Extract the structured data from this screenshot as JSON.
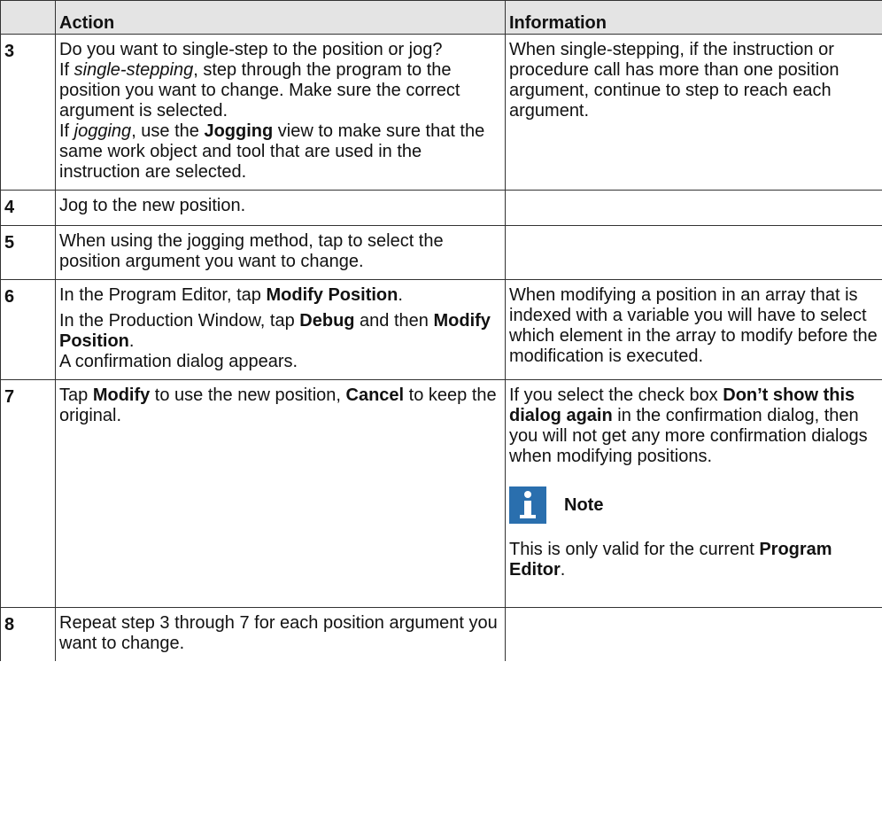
{
  "table": {
    "headers": {
      "step": "",
      "action": "Action",
      "information": "Information"
    },
    "rows": [
      {
        "step": "3",
        "action": {
          "p1": "Do you want to single-step to the position or jog?",
          "p2_pre": "If ",
          "p2_em": "single-stepping",
          "p2_post": ", step through the program to the position you want to change. Make sure the correct argument is selected.",
          "p3_pre": "If ",
          "p3_em": "jogging",
          "p3_mid": ", use the ",
          "p3_bold": "Jogging",
          "p3_post": " view to make sure that the same work object and tool that are used in the instruction are selected."
        },
        "info": "When single-stepping, if the instruction or procedure call has more than one position argument, continue to step to reach each argument."
      },
      {
        "step": "4",
        "action": "Jog to the new position.",
        "info": ""
      },
      {
        "step": "5",
        "action": "When using the jogging method, tap to select the position argument you want to change.",
        "info": ""
      },
      {
        "step": "6",
        "action": {
          "p1_pre": "In the Program Editor, tap ",
          "p1_bold": "Modify Position",
          "p1_post": ".",
          "p2_pre": "In the Production Window, tap ",
          "p2_bold1": "Debug",
          "p2_mid": " and then ",
          "p2_bold2": "Modify Position",
          "p2_post": ".",
          "p3": "A confirmation dialog appears."
        },
        "info": "When modifying a position in an array that is indexed with a variable you will have to select which element in the array to modify before the modification is executed."
      },
      {
        "step": "7",
        "action": {
          "pre": "Tap ",
          "bold1": "Modify",
          "mid": " to use the new position, ",
          "bold2": "Cancel",
          "post": " to keep the original."
        },
        "info": {
          "p1_pre": "If you select the check box ",
          "p1_bold": "Don’t show this dialog again",
          "p1_post": " in the confirmation dialog, then you will not get any more confirmation dialogs when modifying positions.",
          "note_label": "Note",
          "note_icon": "info-icon",
          "note_pre": "This is only valid for the current ",
          "note_bold": "Program Editor",
          "note_post": "."
        }
      },
      {
        "step": "8",
        "action": "Repeat step 3 through 7 for each position argument you want to change.",
        "info": ""
      }
    ]
  }
}
